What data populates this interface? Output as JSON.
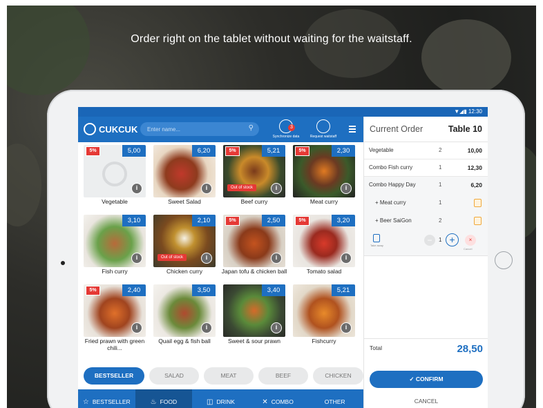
{
  "headline": "Order right on the tablet without waiting for the waitstaff.",
  "status": {
    "time": "12:30"
  },
  "app": {
    "logo": "CUKCUK"
  },
  "search": {
    "placeholder": "Enter name..."
  },
  "tools": {
    "sync_label": "Synchronize data",
    "sync_badge": "3",
    "request_label": "Request waitstaff"
  },
  "menu_items": [
    {
      "name": "Vegetable",
      "price": "5,00",
      "discount": "5%",
      "info": "i"
    },
    {
      "name": "Sweet Salad",
      "price": "6,20",
      "info": "i"
    },
    {
      "name": "Beef curry",
      "price": "5,21",
      "discount": "5%",
      "badge": "Out of stock",
      "info": "i"
    },
    {
      "name": "Meat curry",
      "price": "2,30",
      "discount": "5%",
      "info": "i"
    },
    {
      "name": "Fish curry",
      "price": "3,10",
      "info": "i"
    },
    {
      "name": "Chicken curry",
      "price": "2,10",
      "badge": "Out of stock",
      "info": "i"
    },
    {
      "name": "Japan tofu & chicken ball",
      "price": "2,50",
      "discount": "5%",
      "info": "i"
    },
    {
      "name": "Tomato salad",
      "price": "3,20",
      "discount": "5%",
      "info": "i"
    },
    {
      "name": "Fried prawn with green chili...",
      "price": "2,40",
      "discount": "5%",
      "info": "i"
    },
    {
      "name": "Quail egg & fish ball",
      "price": "3,50",
      "info": "i"
    },
    {
      "name": "Sweet & sour prawn",
      "price": "3,40",
      "info": "i"
    },
    {
      "name": "Fishcurry",
      "price": "5,21",
      "info": "i"
    }
  ],
  "categories": [
    "BESTSELLER",
    "SALAD",
    "MEAT",
    "BEEF",
    "CHICKEN"
  ],
  "bottom_nav": [
    "BESTSELLER",
    "FOOD",
    "DRINK",
    "COMBO",
    "OTHER"
  ],
  "order": {
    "title": "Current Order",
    "table": "Table 10",
    "lines": [
      {
        "name": "Vegetable",
        "qty": "2",
        "price": "10,00"
      },
      {
        "name": "Combo Fish curry",
        "qty": "1",
        "price": "12,30"
      },
      {
        "name": "Combo Happy Day",
        "qty": "1",
        "price": "6,20"
      }
    ],
    "sub_lines": [
      {
        "name": "+ Meat curry",
        "qty": "1"
      },
      {
        "name": "+ Beer SaiGon",
        "qty": "2"
      }
    ],
    "stepper": {
      "takeaway": "Take away",
      "minus": "−",
      "qty": "1",
      "plus": "+",
      "cancel": "Cancel",
      "cancel_symbol": "×"
    },
    "total_label": "Total",
    "total_value": "28,50",
    "confirm_label": "✓ CONFIRM",
    "cancel_label": "CANCEL"
  },
  "colors": {
    "primary": "#1e6fc1",
    "accent_red": "#e53935"
  }
}
